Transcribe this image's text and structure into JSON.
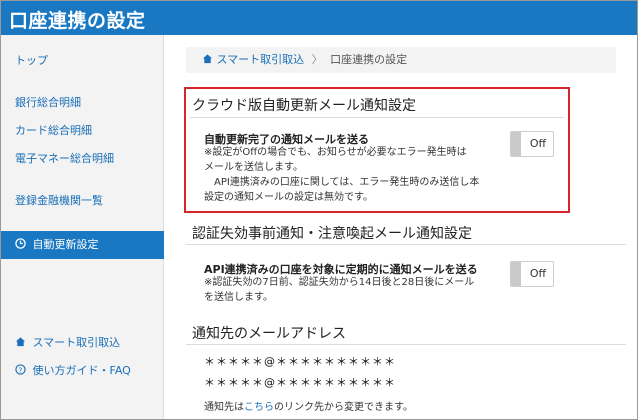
{
  "header": {
    "title": "口座連携の設定"
  },
  "sidebar": {
    "items": [
      {
        "label": "トップ"
      },
      {
        "label": "銀行総合明細"
      },
      {
        "label": "カード総合明細"
      },
      {
        "label": "電子マネー総合明細"
      },
      {
        "label": "登録金融機関一覧"
      },
      {
        "label": "自動更新設定",
        "icon": "clock-icon",
        "active": true
      },
      {
        "label": "スマート取引取込",
        "icon": "home-icon"
      },
      {
        "label": "使い方ガイド・FAQ",
        "icon": "question-icon"
      }
    ]
  },
  "breadcrumb": {
    "home": "スマート取引取込",
    "separator": "〉",
    "current": "口座連携の設定"
  },
  "sections": {
    "cloud": {
      "title": "クラウド版自動更新メール通知設定",
      "label": "自動更新完了の通知メールを送る",
      "desc1": "※設定がOffの場合でも、お知らせが必要なエラー発生時は",
      "desc2": "メールを送信します。",
      "desc3": "　API連携済みの口座に関しては、エラー発生時のみ送信し本",
      "desc4": "設定の通知メールの設定は無効です。",
      "toggle": "Off"
    },
    "auth": {
      "title": "認証失効事前通知・注意喚起メール通知設定",
      "label": "API連携済みの口座を対象に定期的に通知メールを送る",
      "desc1": "※認証失効の7日前、認証失効から14日後と28日後にメール",
      "desc2": "を送信します。",
      "toggle": "Off"
    },
    "email": {
      "title": "通知先のメールアドレス",
      "addr1": "＊＊＊＊＊@＊＊＊＊＊＊＊＊＊＊",
      "addr2": "＊＊＊＊＊@＊＊＊＊＊＊＊＊＊＊",
      "note_prefix": "通知先は",
      "note_link": "こちら",
      "note_suffix": "のリンク先から変更できます。"
    }
  },
  "colors": {
    "brand": "#1a78c2",
    "highlight": "#d6262c",
    "link": "#1a6fb8"
  }
}
